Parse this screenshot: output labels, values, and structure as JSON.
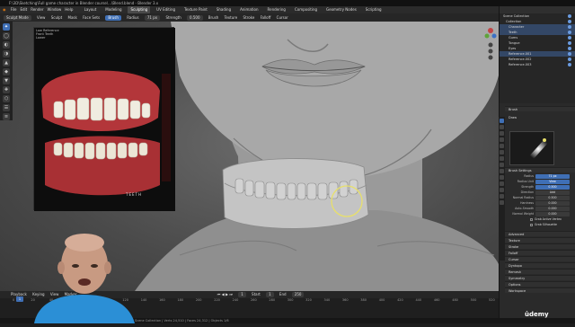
{
  "window": {
    "title": "F:\\3D\\Sketching\\Full game character in Blender course\\...\\Blend.blend - Blender 3.x"
  },
  "menubar": {
    "menus": [
      "File",
      "Edit",
      "Render",
      "Window",
      "Help"
    ],
    "workspaces": [
      "Layout",
      "Modeling",
      "Sculpting",
      "UV Editing",
      "Texture Paint",
      "Shading",
      "Animation",
      "Rendering",
      "Compositing",
      "Geometry Nodes",
      "Scripting"
    ],
    "active_workspace": "Sculpting"
  },
  "header": {
    "mode": "Sculpt Mode",
    "menus": [
      "View",
      "Sculpt",
      "Mask",
      "Face Sets"
    ],
    "brush_label": "Brush",
    "radius_label": "Radius",
    "radius_value": "71 px",
    "strength_label": "Strength",
    "strength_value": "0.500",
    "extra": [
      "Brush",
      "Texture",
      "Stroke",
      "Falloff",
      "Cursor"
    ]
  },
  "viewport": {
    "reference_title": "Low Reference",
    "reference_sub1": "Front Teeth",
    "reference_sub2": "Lower",
    "watermark": "TEETH"
  },
  "toolbar": {
    "tools": [
      "✦",
      "◯",
      "◐",
      "◑",
      "▲",
      "◆",
      "▼",
      "✚",
      "⬡",
      "☰",
      "≡",
      "✋",
      "⤢",
      "◎",
      "⟳",
      "⌒",
      "✎",
      "⬤"
    ],
    "active_index": 0
  },
  "outliner": {
    "rows": [
      {
        "label": "Scene Collection",
        "selected": false
      },
      {
        "label": "Collection",
        "selected": false
      },
      {
        "label": "Character",
        "selected": true
      },
      {
        "label": "Teeth",
        "selected": true
      },
      {
        "label": "Gums",
        "selected": false
      },
      {
        "label": "Tongue",
        "selected": false
      },
      {
        "label": "Eyes",
        "selected": false
      },
      {
        "label": "Reference.001",
        "selected": true
      },
      {
        "label": "Reference.002",
        "selected": false
      },
      {
        "label": "Reference.003",
        "selected": false
      }
    ]
  },
  "properties": {
    "tabs": [
      "Tool",
      "Render",
      "Output",
      "View Layer",
      "Scene",
      "World",
      "Object",
      "Modifiers",
      "Particles",
      "Physics",
      "Constraints",
      "Data",
      "Material",
      "Texture"
    ],
    "brush_header": "Brush",
    "brush_name": "Draw",
    "brush_settings_header": "Brush Settings",
    "fields": [
      {
        "label": "Radius",
        "value": "71 px",
        "highlight": true
      },
      {
        "label": "Radius Unit",
        "value": "View",
        "highlight": true
      },
      {
        "label": "Strength",
        "value": "0.500",
        "highlight": true
      },
      {
        "label": "Direction",
        "value": "Add",
        "highlight": false
      },
      {
        "label": "Normal Radius",
        "value": "0.500",
        "highlight": false
      },
      {
        "label": "Hardness",
        "value": "0.000",
        "highlight": false
      },
      {
        "label": "Auto-Smooth",
        "value": "0.000",
        "highlight": false
      },
      {
        "label": "Normal Weight",
        "value": "0.000",
        "highlight": false
      }
    ],
    "checkboxes": [
      "Grab Active Vertex",
      "Grab Silhouette"
    ],
    "sections": [
      "Advanced",
      "Texture",
      "Stroke",
      "Falloff",
      "Cursor",
      "Dyntopo",
      "Remesh",
      "Symmetry",
      "Options",
      "Workspace"
    ]
  },
  "timeline": {
    "menus": [
      "Playback",
      "Keying",
      "View",
      "Marker"
    ],
    "current_frame": "1",
    "start_label": "Start",
    "start_value": "1",
    "end_label": "End",
    "end_value": "250",
    "ticks": [
      "0",
      "20",
      "40",
      "60",
      "80",
      "100",
      "120",
      "140",
      "160",
      "180",
      "200",
      "220",
      "240",
      "260",
      "280",
      "300",
      "320",
      "340",
      "360",
      "380",
      "400",
      "420",
      "440",
      "460",
      "480",
      "500",
      "520"
    ]
  },
  "status": {
    "text": "Scene Collection | Verts 24,510 | Faces 24,312 | Objects 1/6"
  },
  "brand": {
    "udemy": "ûdemy"
  },
  "colors": {
    "accent": "#3f6fb5",
    "selection_ring": "#e8e06a",
    "viewport_bg": "#5a5a5a"
  }
}
